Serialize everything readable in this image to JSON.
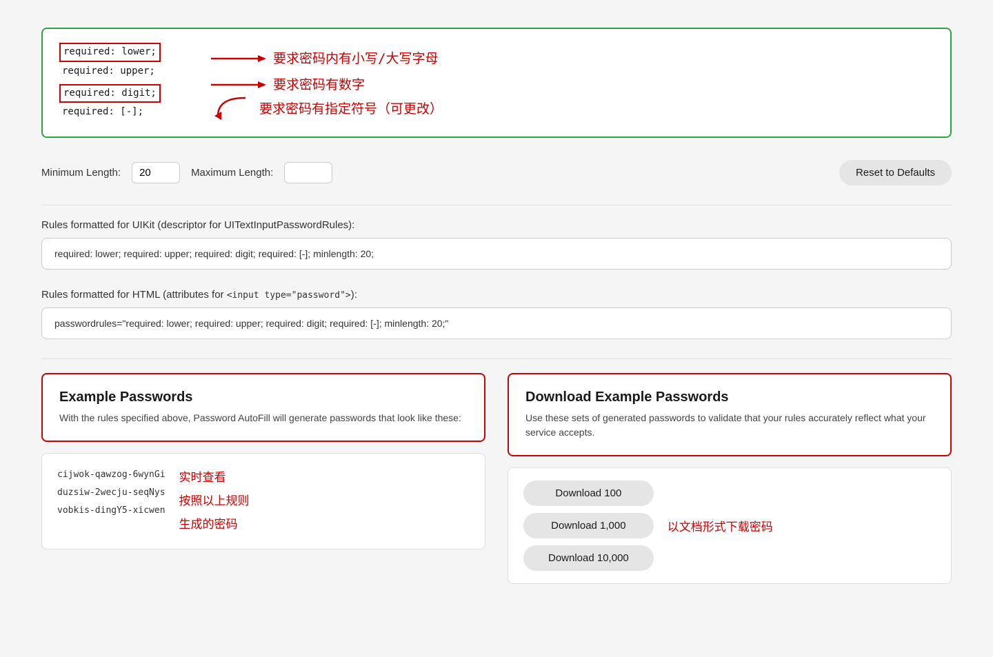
{
  "annotation": {
    "lines": [
      {
        "code": "required: lower;",
        "outlined": true,
        "arrow": "right"
      },
      {
        "code": "required: upper;",
        "outlined": false,
        "arrow": null
      },
      {
        "code": "required: digit;",
        "outlined": true,
        "arrow": "right"
      },
      {
        "code": "required: [-];",
        "outlined": false,
        "arrow": "down-left"
      }
    ],
    "label1": "要求密码内有小写/大写字母",
    "label2": "要求密码有数字",
    "label3": "要求密码有指定符号（可更改）"
  },
  "length": {
    "min_label": "Minimum Length:",
    "min_value": "20",
    "max_label": "Maximum Length:",
    "max_value": ""
  },
  "reset_btn": "Reset to Defaults",
  "uikit": {
    "label": "Rules formatted for UIKit (descriptor for UITextInputPasswordRules):",
    "value": "required: lower; required: upper; required: digit; required: [-]; minlength: 20;"
  },
  "html": {
    "label_prefix": "Rules formatted for HTML (attributes for ",
    "label_code": "<input type=\"password\">",
    "label_suffix": "):",
    "value": "passwordrules=\"required: lower; required: upper; required: digit; required: [-]; minlength: 20;\""
  },
  "example_passwords": {
    "title": "Example Passwords",
    "description": "With the rules specified above, Password AutoFill will generate passwords that look like these:",
    "items": [
      "cijwok-qawzog-6wynGi",
      "duzsiw-2wecju-seqNys",
      "vobkis-dingY5-xicwen"
    ],
    "realtime_label1": "实时查看",
    "realtime_label2": "按照以上规则",
    "realtime_label3": "生成的密码"
  },
  "download_passwords": {
    "title": "Download Example Passwords",
    "description": "Use these sets of generated passwords to validate that your rules accurately reflect what your service accepts.",
    "buttons": [
      "Download 100",
      "Download 1,000",
      "Download 10,000"
    ],
    "note1": "以文档形式下载密码"
  }
}
